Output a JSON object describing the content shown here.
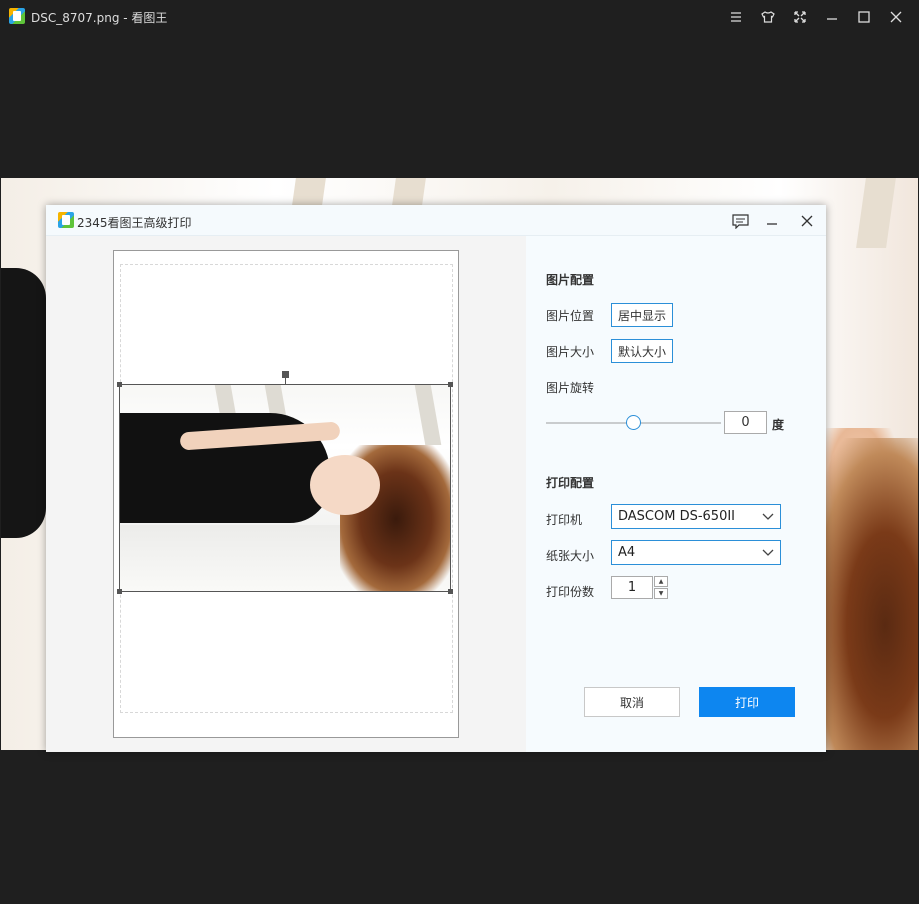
{
  "window": {
    "title": "DSC_8707.png - 看图王",
    "controls": [
      "menu-icon",
      "skin-icon",
      "fullscreen-icon",
      "minimize-icon",
      "maximize-icon",
      "close-icon"
    ]
  },
  "dialog": {
    "title": "2345看图王高级打印",
    "controls": [
      "feedback-icon",
      "minimize-icon",
      "close-icon"
    ]
  },
  "image_settings": {
    "section_title": "图片配置",
    "position_label": "图片位置",
    "position_value": "居中显示",
    "size_label": "图片大小",
    "size_value": "默认大小",
    "rotation_label": "图片旋转",
    "rotation_value": "0",
    "rotation_unit": "度"
  },
  "print_settings": {
    "section_title": "打印配置",
    "printer_label": "打印机",
    "printer_value": "DASCOM DS-650II",
    "paper_label": "纸张大小",
    "paper_value": "A4",
    "copies_label": "打印份数",
    "copies_value": "1"
  },
  "actions": {
    "cancel_label": "取消",
    "print_label": "打印"
  },
  "colors": {
    "accent": "#0d86f0",
    "border_accent": "#2b8fd8",
    "app_background": "#1f1f1f"
  }
}
